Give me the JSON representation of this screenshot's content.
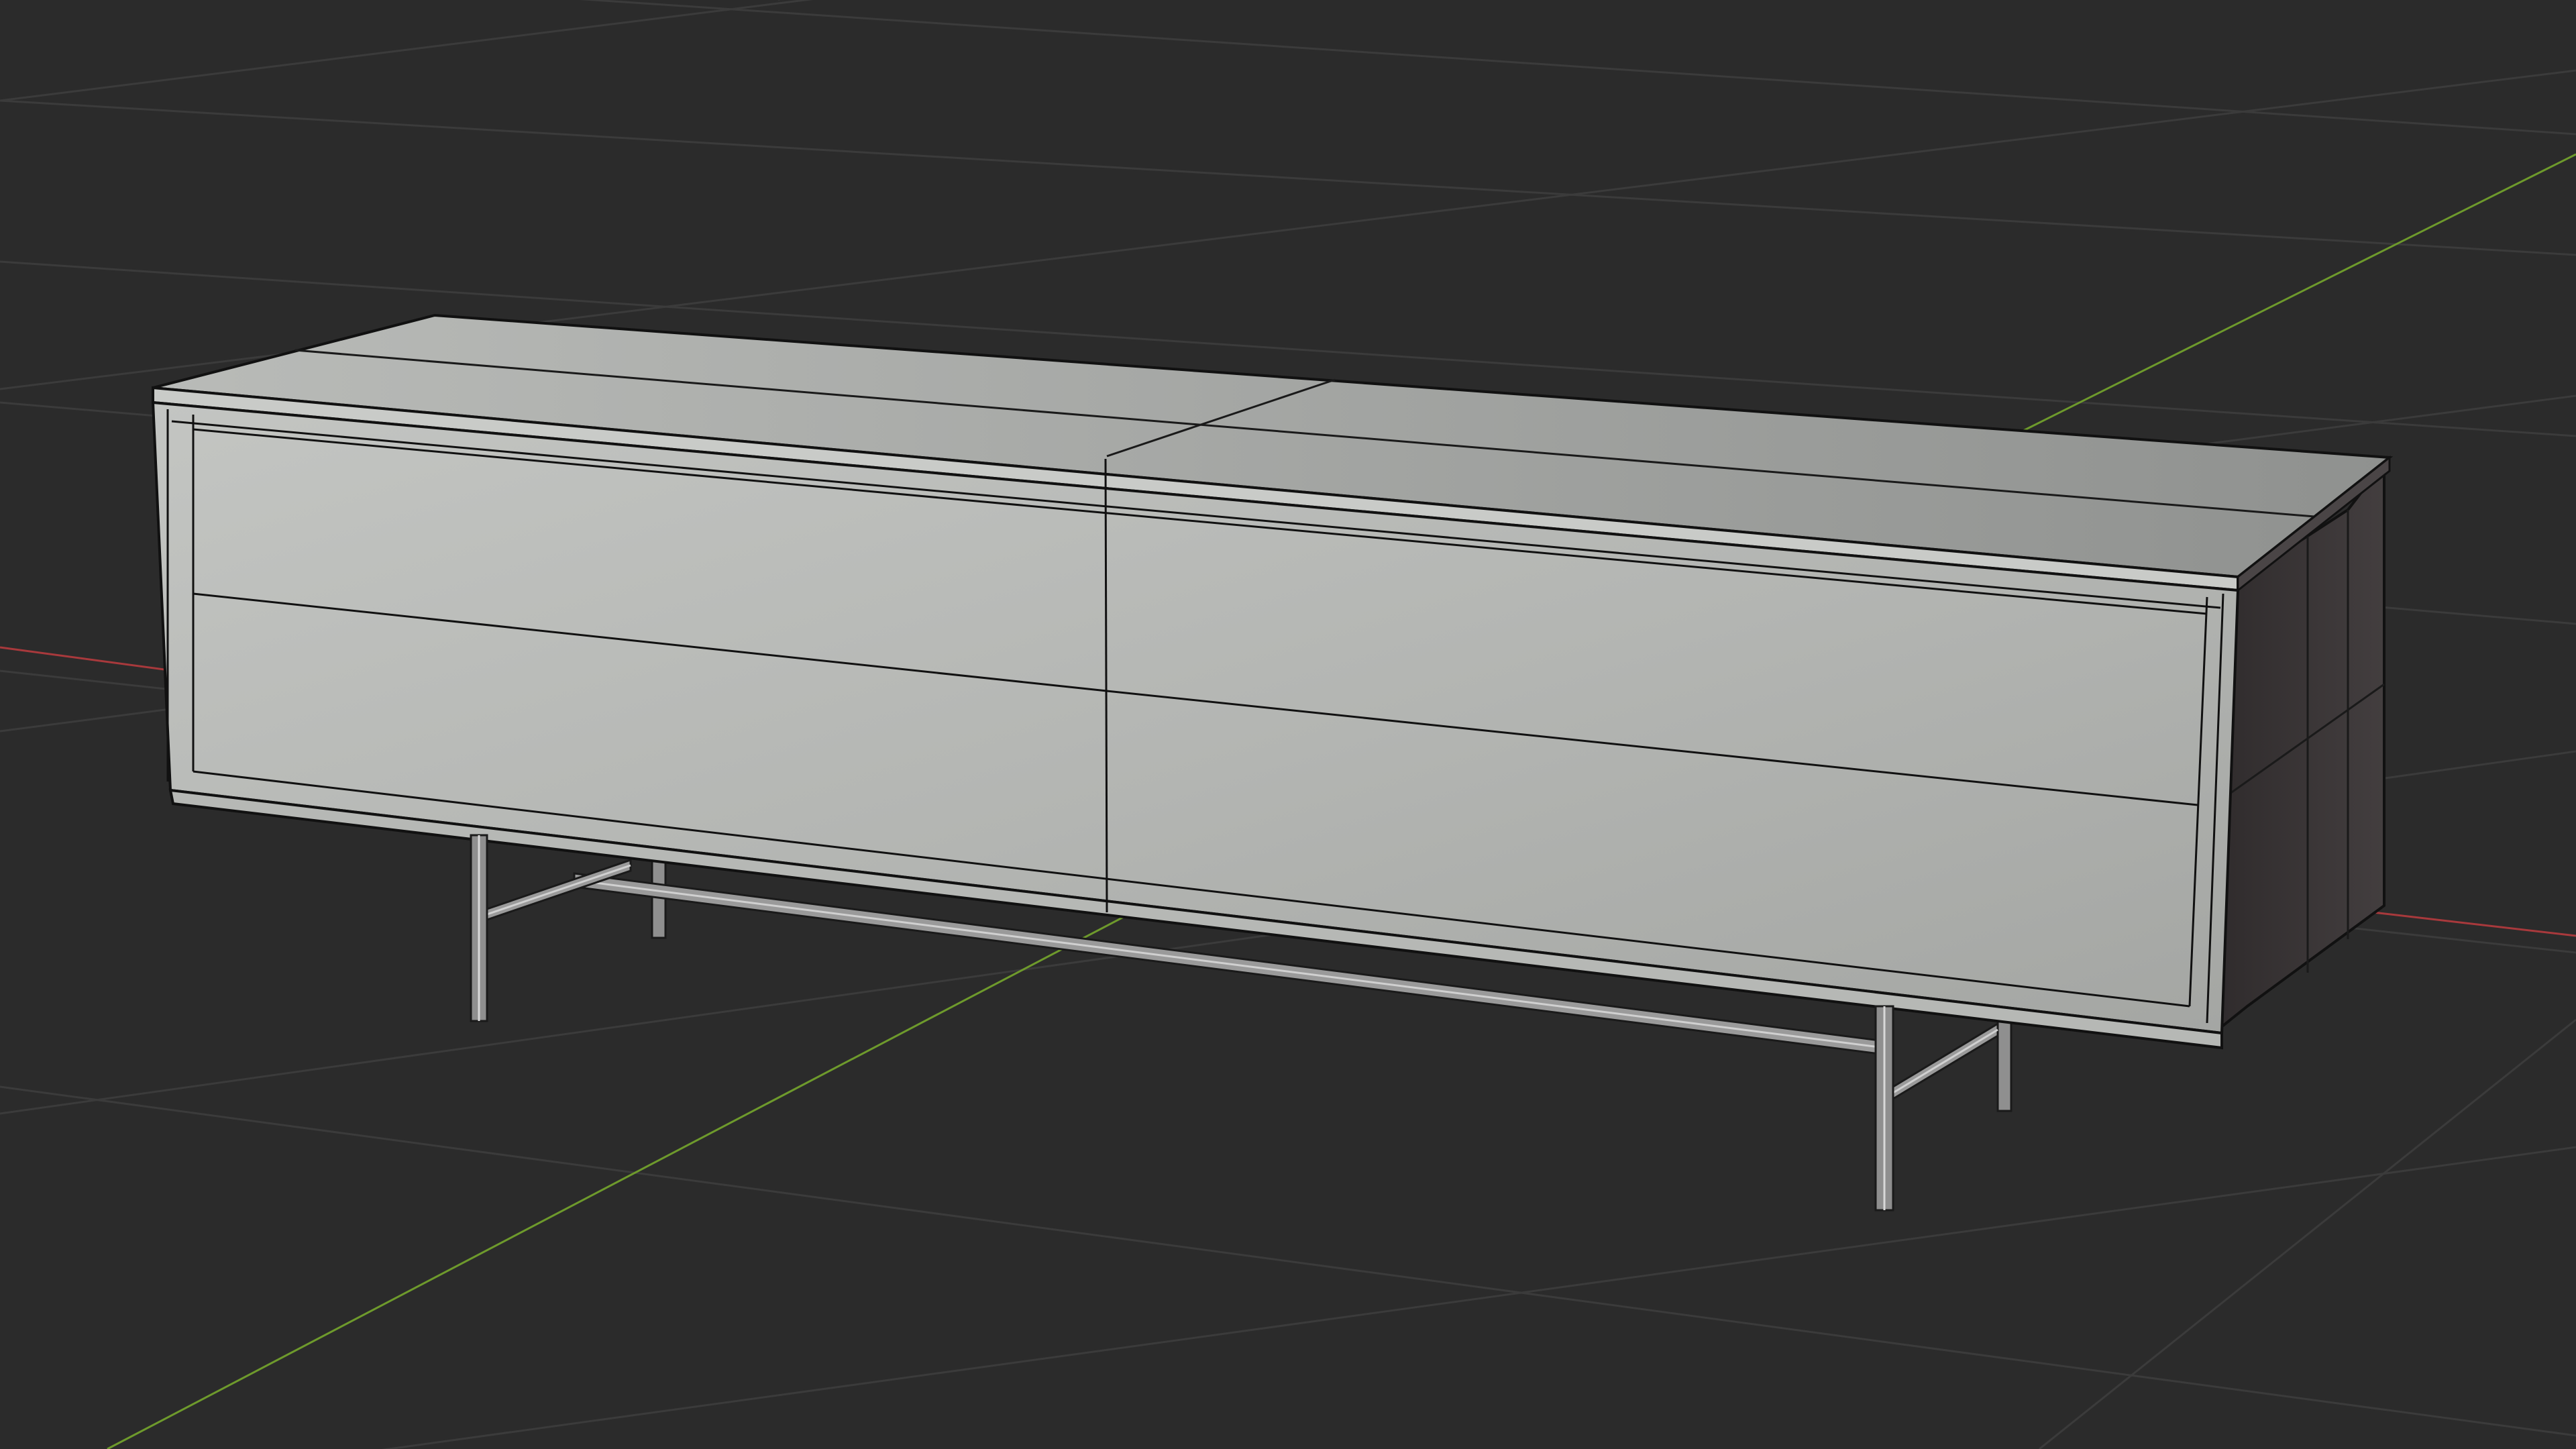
{
  "viewport": {
    "mode": "3d-viewport-wireframe-overlay",
    "background_color": "#2b2b2b",
    "grid_color": "#3c3c3c",
    "x_axis_color": "#a8393c",
    "y_axis_color": "#6e9a2c"
  },
  "model": {
    "object": "sideboard-cabinet",
    "front_panels": 4,
    "legs": 4,
    "surface_color_light": "#bdbfbc",
    "surface_color_mid": "#a8aaa8",
    "side_color": "#3a3637",
    "wire_color": "#111111",
    "leg_color": "#9a9a9a"
  }
}
